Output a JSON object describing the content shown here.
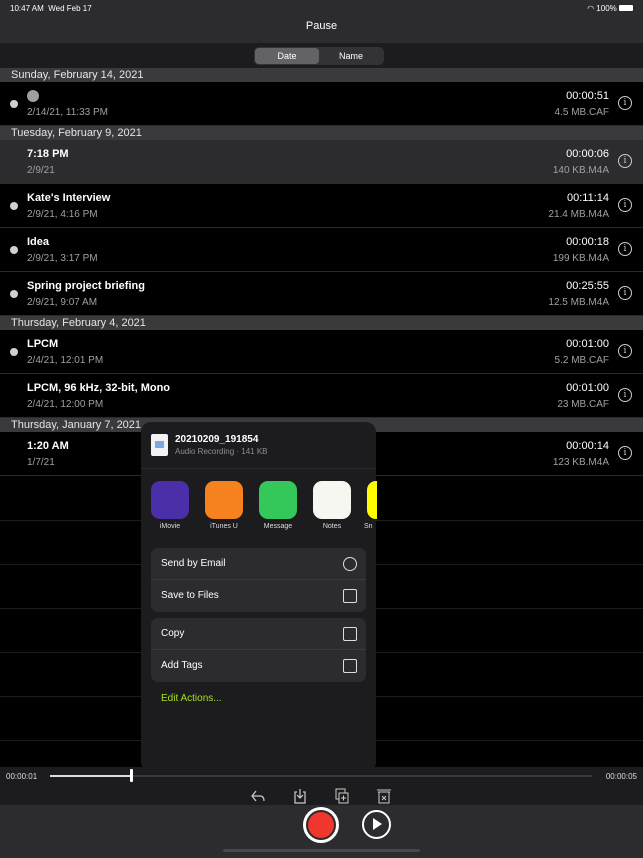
{
  "status": {
    "time": "10:47 AM",
    "date": "Wed Feb 17",
    "battery": "100%"
  },
  "nav": {
    "title": "Pause"
  },
  "segments": [
    {
      "label": "Date",
      "selected": true
    },
    {
      "label": "Name",
      "selected": false
    }
  ],
  "sections": [
    {
      "header": "Sunday, February 14, 2021",
      "rows": [
        {
          "title": "",
          "icon": "alien-emoji",
          "sub": "2/14/21, 11:33 PM",
          "duration": "00:00:51",
          "size": "4.5 MB.CAF",
          "dot": true
        }
      ]
    },
    {
      "header": "Tuesday, February 9, 2021",
      "rows": [
        {
          "title": "7:18 PM",
          "sub": "2/9/21",
          "duration": "00:00:06",
          "size": "140 KB.M4A",
          "dot": false,
          "selected": true
        },
        {
          "title": "Kate's Interview",
          "sub": "2/9/21, 4:16 PM",
          "duration": "00:11:14",
          "size": "21.4 MB.M4A",
          "dot": true
        },
        {
          "title": "Idea",
          "sub": "2/9/21, 3:17 PM",
          "duration": "00:00:18",
          "size": "199 KB.M4A",
          "dot": true
        },
        {
          "title": "Spring project briefing",
          "sub": "2/9/21, 9:07 AM",
          "duration": "00:25:55",
          "size": "12.5 MB.M4A",
          "dot": true
        }
      ]
    },
    {
      "header": "Thursday, February 4, 2021",
      "rows": [
        {
          "title": "LPCM",
          "sub": "2/4/21, 12:01 PM",
          "duration": "00:01:00",
          "size": "5.2 MB.CAF",
          "dot": true
        },
        {
          "title": "LPCM, 96 kHz, 32-bit, Mono",
          "sub": "2/4/21, 12:00 PM",
          "duration": "00:01:00",
          "size": "23 MB.CAF",
          "dot": false
        }
      ]
    },
    {
      "header": "Thursday, January 7, 2021",
      "rows": [
        {
          "title": "1:20 AM",
          "sub": "1/7/21",
          "duration": "00:00:14",
          "size": "123 KB.M4A",
          "dot": false
        }
      ]
    }
  ],
  "share": {
    "file_name": "20210209_191854",
    "file_meta": "Audio Recording · 141 KB",
    "apps": [
      {
        "label": "iMovie",
        "color": "#4b2fa8"
      },
      {
        "label": "iTunes U",
        "color": "#f5811f"
      },
      {
        "label": "Message",
        "color": "#34c759"
      },
      {
        "label": "Notes",
        "color": "#f7f7f2"
      },
      {
        "label": "Sn",
        "color": "#fffc00"
      }
    ],
    "groups": [
      [
        {
          "label": "Send by Email",
          "icon": "email-icon"
        },
        {
          "label": "Save to Files",
          "icon": "folder-icon"
        }
      ],
      [
        {
          "label": "Copy",
          "icon": "copy-icon"
        },
        {
          "label": "Add Tags",
          "icon": "tag-icon"
        }
      ]
    ],
    "edit_actions": "Edit Actions...",
    "accent": "#a6e01c"
  },
  "player": {
    "current": "00:00:01",
    "total": "00:00:05",
    "progress": 0.15,
    "record_color": "#f0362d"
  }
}
